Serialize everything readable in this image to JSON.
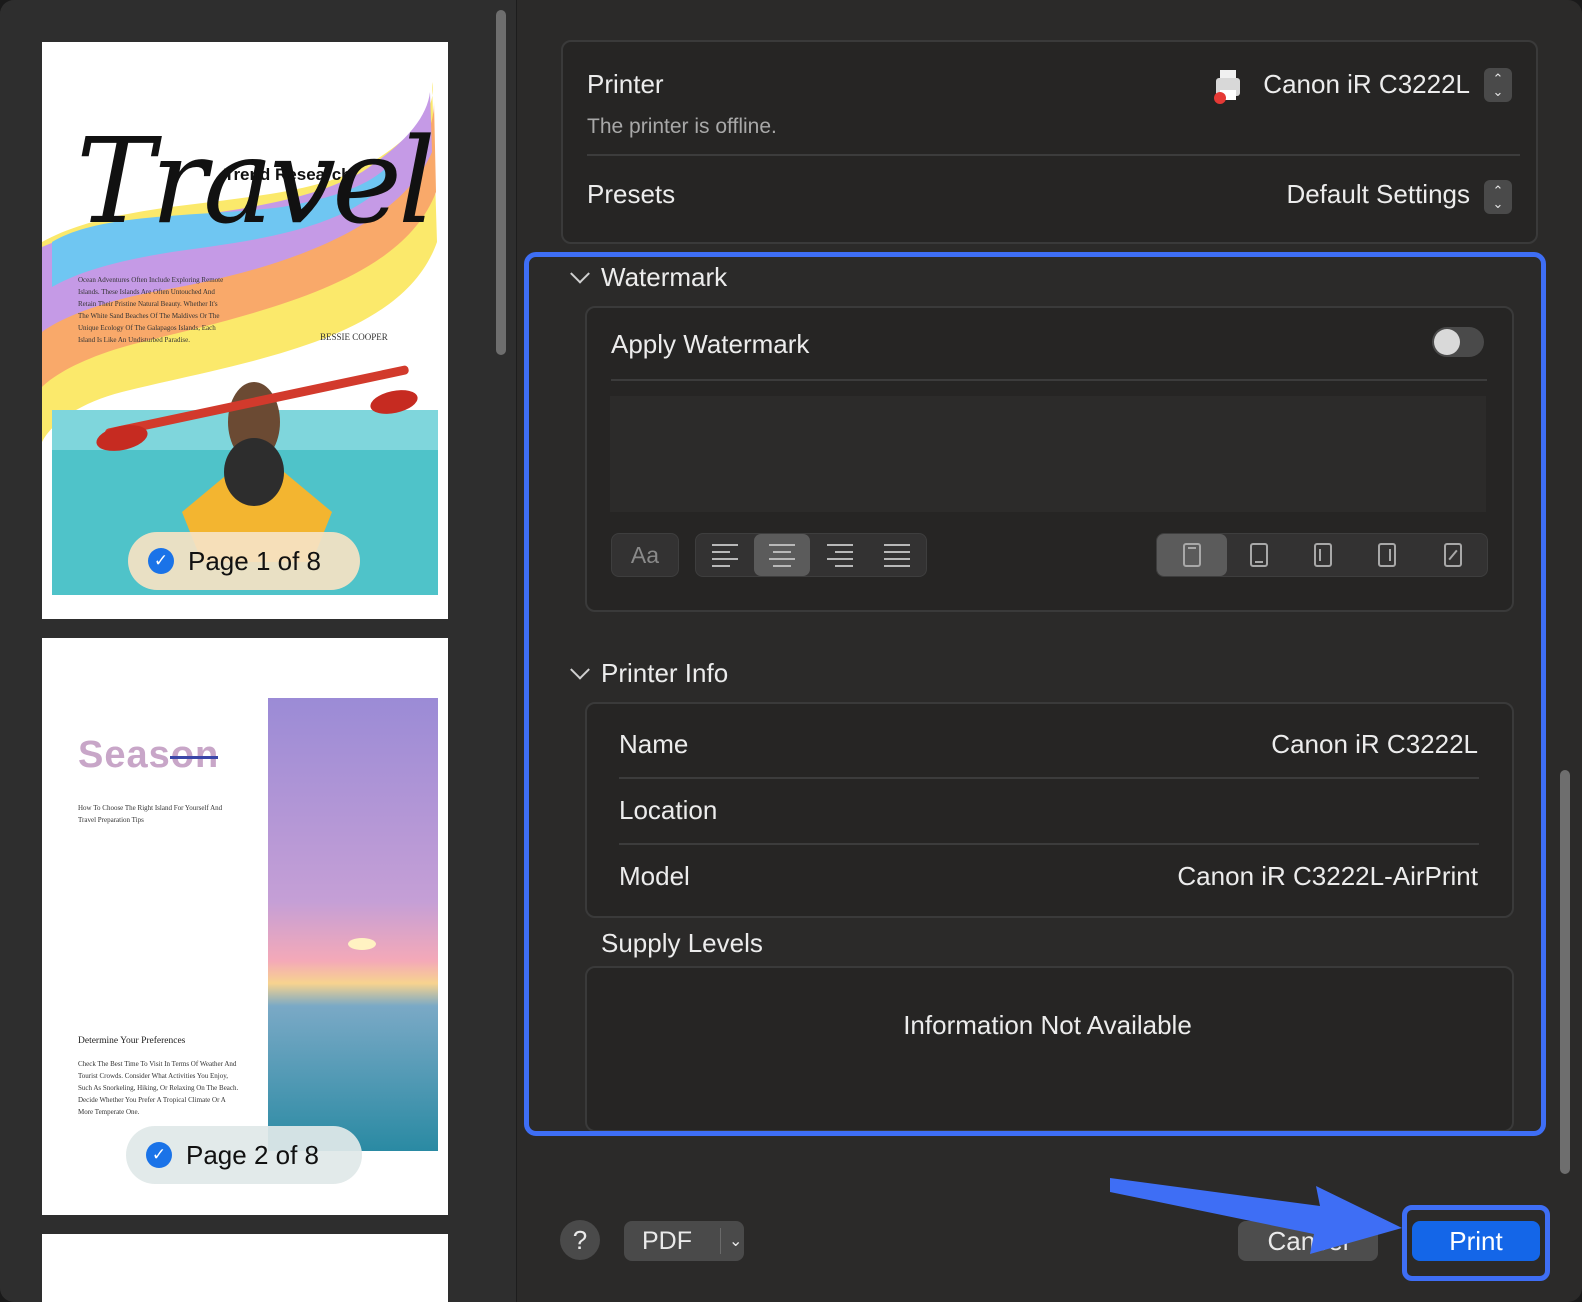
{
  "pages": [
    {
      "badge": "Page 1 of 8",
      "title_script": "Travel",
      "subtitle": "Trend Research",
      "body": "Ocean Adventures Often Include Exploring Remote Islands. These Islands Are Often Untouched And Retain Their Pristine Natural Beauty. Whether It's The White Sand Beaches Of The Maldives Or The Unique Ecology Of The Galapagos Islands, Each Island Is Like An Undisturbed Paradise.",
      "author": "BESSIE COOPER"
    },
    {
      "badge": "Page 2 of 8",
      "title": "Season",
      "intro": "How To Choose The Right Island For Yourself And Travel Preparation Tips",
      "heading": "Determine Your Preferences",
      "body": "Check The Best Time To Visit In Terms Of Weather And Tourist Crowds. Consider What Activities You Enjoy, Such As Snorkeling, Hiking, Or Relaxing On The Beach. Decide Whether You Prefer A Tropical Climate Or A More Temperate One."
    }
  ],
  "printer": {
    "label": "Printer",
    "value": "Canon iR C3222L",
    "status": "The printer is offline.",
    "icon": "printer-icon"
  },
  "presets": {
    "label": "Presets",
    "value": "Default Settings"
  },
  "watermark": {
    "section": "Watermark",
    "apply_label": "Apply Watermark",
    "apply_on": false,
    "font_button": "Aa"
  },
  "printer_info": {
    "section": "Printer Info",
    "rows": [
      {
        "label": "Name",
        "value": "Canon iR C3222L"
      },
      {
        "label": "Location",
        "value": ""
      },
      {
        "label": "Model",
        "value": "Canon iR C3222L-AirPrint"
      }
    ]
  },
  "supply": {
    "section": "Supply Levels",
    "message": "Information Not Available"
  },
  "footer": {
    "help": "?",
    "pdf": "PDF",
    "cancel": "Cancel",
    "print": "Print"
  },
  "colors": {
    "accent": "#1466e8",
    "highlight": "#3e6ef5"
  }
}
